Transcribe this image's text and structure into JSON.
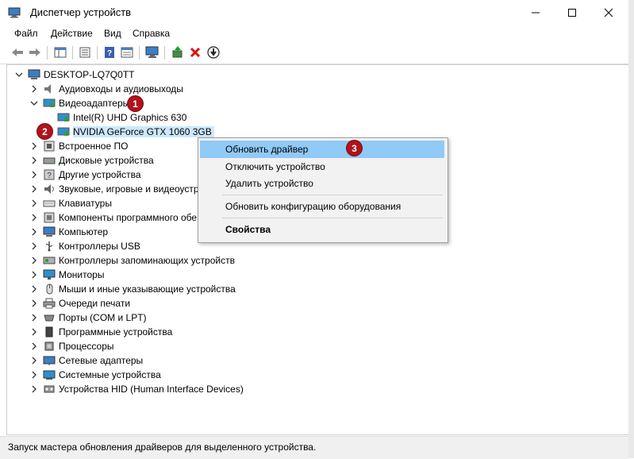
{
  "window": {
    "title": "Диспетчер устройств"
  },
  "menu": [
    "Файл",
    "Действие",
    "Вид",
    "Справка"
  ],
  "tree": {
    "root": "DESKTOP-LQ7Q0TT",
    "categories": [
      {
        "label": "Аудиовходы и аудиовыходы",
        "icon": "audio-io-icon"
      },
      {
        "label": "Видеоадаптеры",
        "icon": "display-adapter-icon",
        "expanded": true,
        "children": [
          {
            "label": "Intel(R) UHD Graphics 630",
            "icon": "display-adapter-icon"
          },
          {
            "label": "NVIDIA GeForce GTX 1060 3GB",
            "icon": "display-adapter-icon",
            "selected": true
          }
        ]
      },
      {
        "label": "Встроенное ПО",
        "icon": "firmware-icon"
      },
      {
        "label": "Дисковые устройства",
        "icon": "disk-icon"
      },
      {
        "label": "Другие устройства",
        "icon": "unknown-device-icon"
      },
      {
        "label": "Звуковые, игровые и видеоустр",
        "icon": "speaker-icon"
      },
      {
        "label": "Клавиатуры",
        "icon": "keyboard-icon"
      },
      {
        "label": "Компоненты программного обе",
        "icon": "software-component-icon"
      },
      {
        "label": "Компьютер",
        "icon": "computer-icon"
      },
      {
        "label": "Контроллеры USB",
        "icon": "usb-icon"
      },
      {
        "label": "Контроллеры запоминающих устройств",
        "icon": "storage-controller-icon"
      },
      {
        "label": "Мониторы",
        "icon": "monitor-icon"
      },
      {
        "label": "Мыши и иные указывающие устройства",
        "icon": "mouse-icon"
      },
      {
        "label": "Очереди печати",
        "icon": "printer-icon"
      },
      {
        "label": "Порты (COM и LPT)",
        "icon": "port-icon"
      },
      {
        "label": "Программные устройства",
        "icon": "software-device-icon"
      },
      {
        "label": "Процессоры",
        "icon": "processor-icon"
      },
      {
        "label": "Сетевые адаптеры",
        "icon": "network-adapter-icon"
      },
      {
        "label": "Системные устройства",
        "icon": "system-device-icon"
      },
      {
        "label": "Устройства HID (Human Interface Devices)",
        "icon": "hid-icon"
      }
    ]
  },
  "context_menu": {
    "items": [
      "Обновить драйвер",
      "Отключить устройство",
      "Удалить устройство",
      "Обновить конфигурацию оборудования",
      "Свойства"
    ]
  },
  "badges": [
    "1",
    "2",
    "3"
  ],
  "status": {
    "text": "Запуск мастера обновления драйверов для выделенного устройства."
  },
  "colors": {
    "badge": "#b2131a",
    "selection": "#cce8ff",
    "menu_highlight": "#91c9f7"
  }
}
